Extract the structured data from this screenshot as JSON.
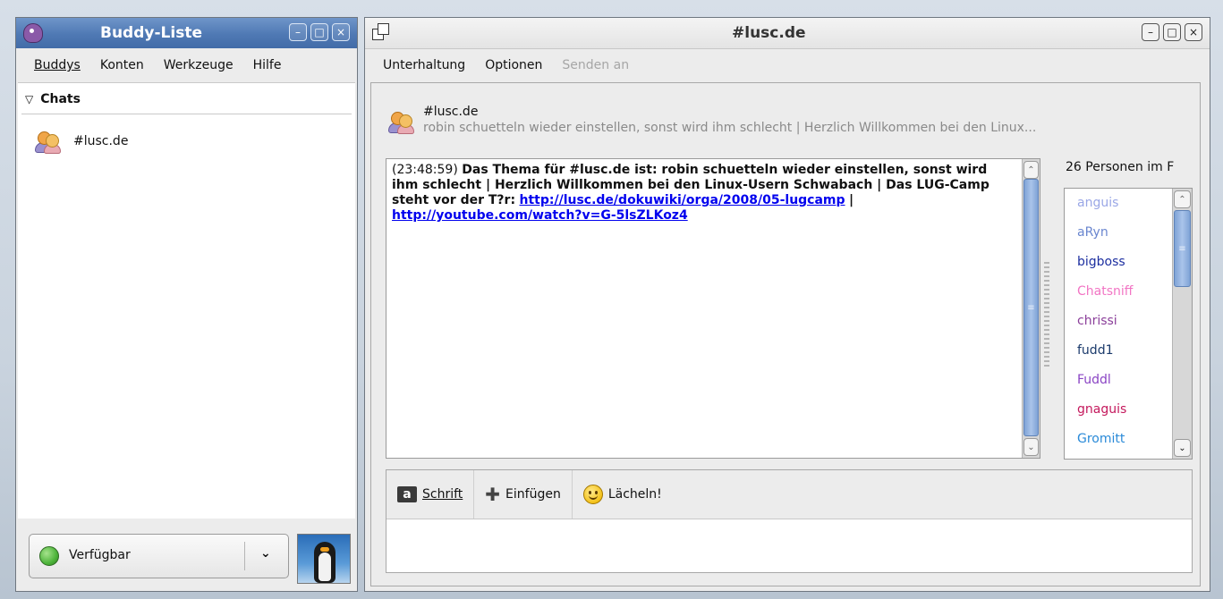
{
  "buddy_window": {
    "title": "Buddy-Liste",
    "menu": [
      "Buddys",
      "Konten",
      "Werkzeuge",
      "Hilfe"
    ],
    "group_label": "Chats",
    "items": [
      {
        "label": "#lusc.de",
        "icon": "chat-people-icon"
      }
    ],
    "status": {
      "label": "Verfügbar",
      "indicator_color": "#4db43a"
    }
  },
  "chat_window": {
    "title": "#lusc.de",
    "menu": {
      "items": [
        "Unterhaltung",
        "Optionen"
      ],
      "disabled": "Senden an"
    },
    "header": {
      "name": "#lusc.de",
      "topic": "robin schuetteln wieder einstellen, sonst wird ihm schlecht | Herzlich Willkommen bei den Linux..."
    },
    "message": {
      "timestamp": "(23:48:59)",
      "text": "Das Thema für #lusc.de ist: robin schuetteln wieder einstellen, sonst wird ihm schlecht | Herzlich Willkommen bei den Linux-Usern Schwabach | Das LUG-Camp steht vor der T?r:",
      "link1": "http://lusc.de/dokuwiki/orga/2008/05-lugcamp",
      "separator": "|",
      "link2": "http://youtube.com/watch?v=G-5lsZLKoz4"
    },
    "people_count": "26 Personen im F",
    "users": [
      {
        "name": "anguis",
        "color": "#9aa7e6"
      },
      {
        "name": "aRyn",
        "color": "#6a86cf"
      },
      {
        "name": "bigboss",
        "color": "#1d2fa0"
      },
      {
        "name": "Chatsniff",
        "color": "#f275c4"
      },
      {
        "name": "chrissi",
        "color": "#8b3f9a"
      },
      {
        "name": "fudd1",
        "color": "#1b3a6b"
      },
      {
        "name": "Fuddl",
        "color": "#8a44c4"
      },
      {
        "name": "gnaguis",
        "color": "#c4185c"
      },
      {
        "name": "Gromitt",
        "color": "#2a8ad8"
      }
    ],
    "toolbar": {
      "font": "Schrift",
      "insert": "Einfügen",
      "smile": "Lächeln!"
    }
  }
}
